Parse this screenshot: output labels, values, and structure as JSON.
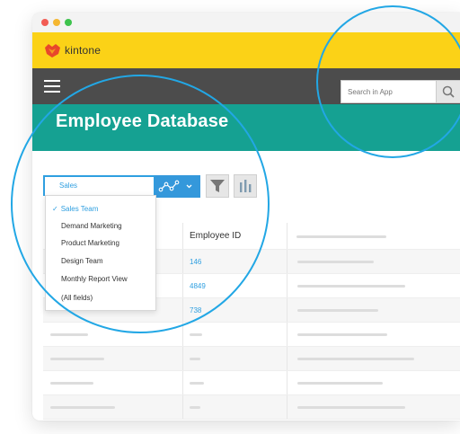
{
  "brand": {
    "name": "kintone",
    "logo_icon": "kintone-logo-icon",
    "bar_color": "#fbd217"
  },
  "navbar": {
    "menu_icon": "hamburger-menu-icon",
    "search_placeholder": "Search in App",
    "search_icon": "magnifier-search-icon"
  },
  "app": {
    "title": "Employee Database",
    "header_color": "#15a192"
  },
  "toolbar": {
    "view_selected": "Sales",
    "graph_icon": "graph-line-icon",
    "dropdown_arrow_icon": "chevron-down-icon",
    "filter_icon": "filter-funnel-icon",
    "stats_icon": "bar-stats-icon",
    "accent_color": "#2f9fe0"
  },
  "view_menu": {
    "items": [
      {
        "label": "Sales Team",
        "selected": true
      },
      {
        "label": "Demand Marketing"
      },
      {
        "label": "Product Marketing"
      },
      {
        "label": "Design Team"
      },
      {
        "label": "Monthly Report View"
      },
      {
        "label": "(All fields)"
      }
    ]
  },
  "table": {
    "columns": [
      "Employee ID"
    ],
    "rows": [
      {
        "employee_id": "146"
      },
      {
        "employee_id": "4849"
      },
      {
        "employee_id": "738"
      }
    ]
  },
  "highlight_color": "#22a7e5"
}
